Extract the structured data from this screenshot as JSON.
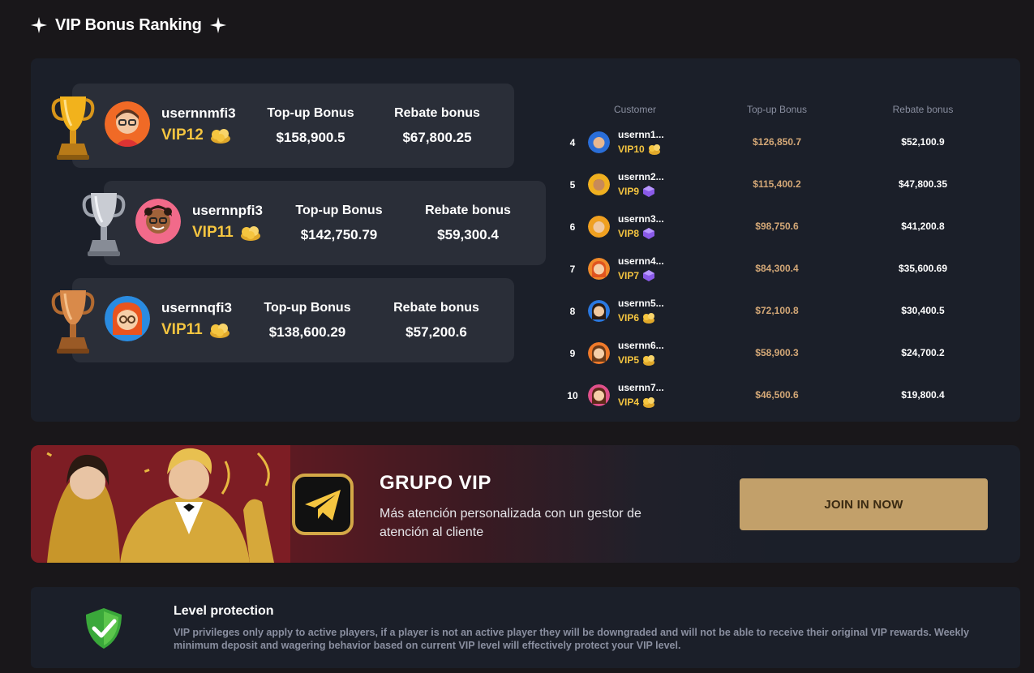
{
  "header": {
    "title": "VIP Bonus Ranking",
    "icon": "sparkle-icon"
  },
  "podium": [
    {
      "rank": 1,
      "username": "usernnmfi3",
      "vip": "VIP12",
      "topup_label": "Top-up Bonus",
      "topup": "$158,900.5",
      "rebate_label": "Rebate bonus",
      "rebate": "$67,800.25",
      "trophy": "gold-trophy-icon"
    },
    {
      "rank": 2,
      "username": "usernnpfi3",
      "vip": "VIP11",
      "topup_label": "Top-up Bonus",
      "topup": "$142,750.79",
      "rebate_label": "Rebate bonus",
      "rebate": "$59,300.4",
      "trophy": "silver-trophy-icon"
    },
    {
      "rank": 3,
      "username": "usernnqfi3",
      "vip": "VIP11",
      "topup_label": "Top-up Bonus",
      "topup": "$138,600.29",
      "rebate_label": "Rebate bonus",
      "rebate": "$57,200.6",
      "trophy": "bronze-trophy-icon"
    }
  ],
  "table": {
    "headers": {
      "customer": "Customer",
      "topup": "Top-up Bonus",
      "rebate": "Rebate bonus"
    },
    "rows": [
      {
        "rank": "4",
        "username": "usernn1...",
        "vip": "VIP10",
        "topup": "$126,850.7",
        "rebate": "$52,100.9"
      },
      {
        "rank": "5",
        "username": "usernn2...",
        "vip": "VIP9",
        "topup": "$115,400.2",
        "rebate": "$47,800.35"
      },
      {
        "rank": "6",
        "username": "usernn3...",
        "vip": "VIP8",
        "topup": "$98,750.6",
        "rebate": "$41,200.8"
      },
      {
        "rank": "7",
        "username": "usernn4...",
        "vip": "VIP7",
        "topup": "$84,300.4",
        "rebate": "$35,600.69"
      },
      {
        "rank": "8",
        "username": "usernn5...",
        "vip": "VIP6",
        "topup": "$72,100.8",
        "rebate": "$30,400.5"
      },
      {
        "rank": "9",
        "username": "usernn6...",
        "vip": "VIP5",
        "topup": "$58,900.3",
        "rebate": "$24,700.2"
      },
      {
        "rank": "10",
        "username": "usernn7...",
        "vip": "VIP4",
        "topup": "$46,500.6",
        "rebate": "$19,800.4"
      }
    ]
  },
  "banner": {
    "title": "GRUPO VIP",
    "description": "Más atención personalizada con un gestor de atención al cliente",
    "button": "JOIN IN NOW",
    "icon": "telegram-icon"
  },
  "protection": {
    "title": "Level protection",
    "text": "VIP privileges only apply to active players, if a player is not an active player they will be downgraded and will not be able to receive their original VIP rewards. Weekly minimum deposit and wagering behavior based on current VIP level will effectively protect your VIP level.",
    "icon": "shield-check-icon"
  },
  "colors": {
    "accent_gold": "#f5c540",
    "button": "#c2a06a",
    "panel": "#1b1f29",
    "card": "#2a2e38"
  }
}
